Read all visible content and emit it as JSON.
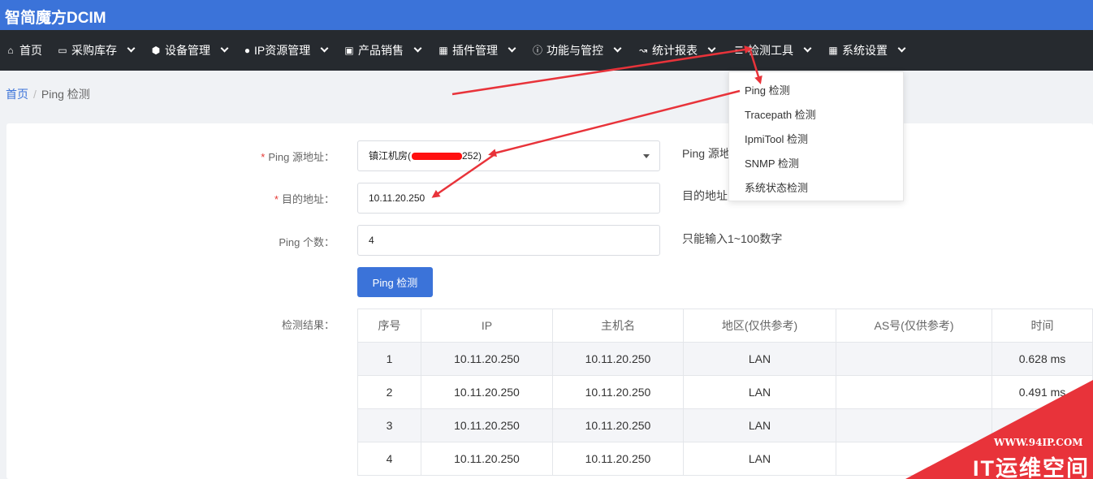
{
  "app": {
    "title": "智简魔方DCIM"
  },
  "nav": {
    "items": [
      {
        "label": "首页",
        "icon": "home-icon"
      },
      {
        "label": "采购库存",
        "icon": "inbox-icon"
      },
      {
        "label": "设备管理",
        "icon": "cube-icon"
      },
      {
        "label": "IP资源管理",
        "icon": "map-marker-icon"
      },
      {
        "label": "产品销售",
        "icon": "cart-icon"
      },
      {
        "label": "插件管理",
        "icon": "grid-icon"
      },
      {
        "label": "功能与管控",
        "icon": "info-icon"
      },
      {
        "label": "统计报表",
        "icon": "line-chart-icon"
      },
      {
        "label": "检测工具",
        "icon": "list-icon"
      },
      {
        "label": "系统设置",
        "icon": "windows-icon"
      }
    ]
  },
  "dropdown": {
    "items": [
      "Ping 检测",
      "Tracepath 检测",
      "IpmiTool 检测",
      "SNMP 检测",
      "系统状态检测"
    ]
  },
  "breadcrumb": {
    "home": "首页",
    "separator": "/",
    "current": "Ping 检测"
  },
  "form": {
    "source": {
      "label": "Ping 源地址：",
      "value_prefix": "镇江机房(",
      "value_suffix": "252)",
      "hint": "Ping 源地"
    },
    "target": {
      "label": "目的地址：",
      "value": "10.11.20.250",
      "hint": "目的地址"
    },
    "count": {
      "label": "Ping 个数：",
      "value": "4",
      "hint": "只能输入1~100数字"
    },
    "submit_label": "Ping 检测",
    "result_label": "检测结果："
  },
  "results": {
    "headers": [
      "序号",
      "IP",
      "主机名",
      "地区(仅供参考)",
      "AS号(仅供参考)",
      "时间"
    ],
    "rows": [
      [
        "1",
        "10.11.20.250",
        "10.11.20.250",
        "LAN",
        "",
        "0.628 ms"
      ],
      [
        "2",
        "10.11.20.250",
        "10.11.20.250",
        "LAN",
        "",
        "0.491 ms"
      ],
      [
        "3",
        "10.11.20.250",
        "10.11.20.250",
        "LAN",
        "",
        ""
      ],
      [
        "4",
        "10.11.20.250",
        "10.11.20.250",
        "LAN",
        "",
        ""
      ]
    ]
  },
  "watermark": {
    "url": "WWW.94IP.COM",
    "text": "IT运维空间"
  },
  "colors": {
    "primary": "#3b73d9",
    "navbar": "#262a2f",
    "annotation": "#e8333a"
  }
}
